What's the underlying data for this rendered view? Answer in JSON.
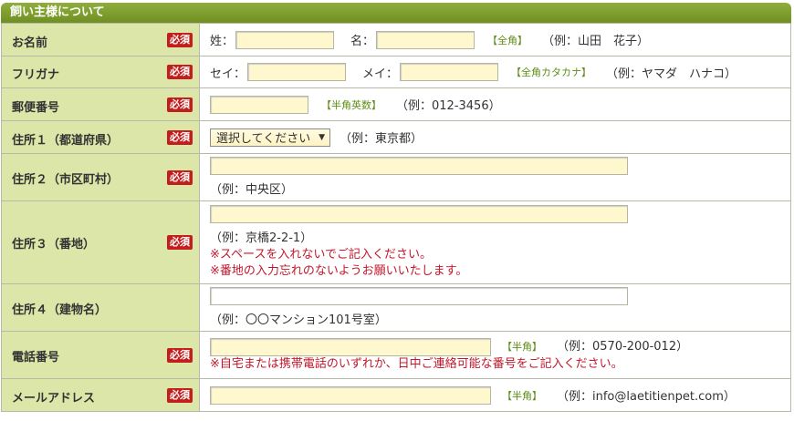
{
  "section_title": "飼い主様について",
  "required_badge": "必須",
  "rows": {
    "name": {
      "label": "お名前",
      "sei_label": "姓：",
      "mei_label": "名：",
      "note": "【全角】",
      "example": "（例：山田　花子）"
    },
    "kana": {
      "label": "フリガナ",
      "sei_label": "セイ：",
      "mei_label": "メイ：",
      "note": "【全角カタカナ】",
      "example": "（例：ヤマダ　ハナコ）"
    },
    "postal": {
      "label": "郵便番号",
      "note": "【半角英数】",
      "example": "（例：012-3456）"
    },
    "addr1": {
      "label": "住所１（都道府県）",
      "select_value": "選択してください",
      "example": "（例：東京都）"
    },
    "addr2": {
      "label": "住所２（市区町村）",
      "example": "（例：中央区）"
    },
    "addr3": {
      "label": "住所３（番地）",
      "example": "（例：京橋2-2-1）",
      "warn1": "※スペースを入れないでご記入ください。",
      "warn2": "※番地の入力忘れのないようお願いいたします。"
    },
    "addr4": {
      "label": "住所４（建物名）",
      "example": "（例：〇〇マンション101号室）"
    },
    "phone": {
      "label": "電話番号",
      "note": "【半角】",
      "example": "（例：0570-200-012）",
      "warn": "※自宅または携帯電話のいずれか、日中ご連絡可能な番号をご記入ください。"
    },
    "email": {
      "label": "メールアドレス",
      "note": "【半角】",
      "example": "（例：info@laetitienpet.com）"
    }
  }
}
